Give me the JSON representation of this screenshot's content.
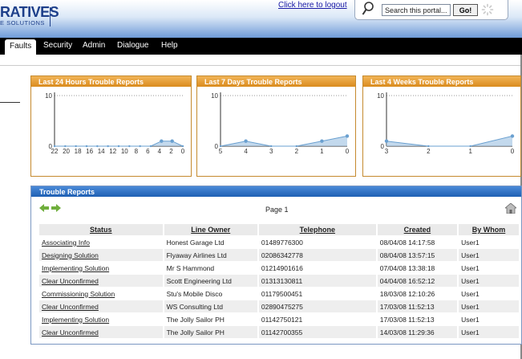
{
  "header": {
    "logo_main": "RATIVES",
    "logo_sub": "E SOLUTIONS",
    "logout_link": "Click here to logout",
    "search": {
      "value": "Search this portal...",
      "button": "Go!"
    }
  },
  "nav": {
    "tabs": [
      {
        "label": "Faults",
        "active": true
      },
      {
        "label": "Security",
        "active": false
      },
      {
        "label": "Admin",
        "active": false
      },
      {
        "label": "Dialogue",
        "active": false
      },
      {
        "label": "Help",
        "active": false
      }
    ]
  },
  "panels": [
    {
      "title": "Last 24 Hours Trouble Reports",
      "chart_data": {
        "type": "area",
        "x_ticks": [
          "22",
          "20",
          "18",
          "16",
          "14",
          "12",
          "10",
          "8",
          "6",
          "4",
          "2",
          "0"
        ],
        "ylim": [
          0,
          10
        ],
        "y_ticks": [
          "10",
          "0"
        ],
        "values": [
          0,
          0,
          0,
          0,
          0,
          0,
          0,
          0,
          0,
          0,
          1,
          1,
          0
        ]
      }
    },
    {
      "title": "Last 7 Days Trouble Reports",
      "chart_data": {
        "type": "area",
        "x_ticks": [
          "5",
          "4",
          "3",
          "2",
          "1",
          "0"
        ],
        "ylim": [
          0,
          10
        ],
        "y_ticks": [
          "10",
          "0"
        ],
        "values": [
          0,
          1,
          0,
          0,
          1,
          2
        ]
      }
    },
    {
      "title": "Last 4 Weeks Trouble Reports",
      "chart_data": {
        "type": "area",
        "x_ticks": [
          "3",
          "2",
          "1",
          "0"
        ],
        "ylim": [
          0,
          10
        ],
        "y_ticks": [
          "10",
          "0"
        ],
        "values": [
          1,
          0,
          0,
          2
        ]
      }
    }
  ],
  "reports": {
    "title": "Trouble Reports",
    "page_label": "Page 1",
    "columns": [
      "Status",
      "Line Owner",
      "Telephone",
      "Created",
      "By Whom"
    ],
    "rows": [
      {
        "status": "Associating Info",
        "owner": "Honest Garage Ltd",
        "telephone": "01489776300",
        "created": "08/04/08 14:17:58",
        "by": "User1"
      },
      {
        "status": "Designing Solution",
        "owner": "Flyaway Airlines Ltd",
        "telephone": "02086342778",
        "created": "08/04/08 13:57:15",
        "by": "User1"
      },
      {
        "status": "Implementing Solution",
        "owner": "Mr S Hammond",
        "telephone": "01214901616",
        "created": "07/04/08 13:38:18",
        "by": "User1"
      },
      {
        "status": "Clear Unconfirmed",
        "owner": "Scott Engineering Ltd",
        "telephone": "01313130811",
        "created": "04/04/08 16:52:12",
        "by": "User1"
      },
      {
        "status": "Commissioning Solution",
        "owner": "Stu's Mobile Disco",
        "telephone": "01179500451",
        "created": "18/03/08 12:10:26",
        "by": "User1"
      },
      {
        "status": "Clear Unconfirmed",
        "owner": "WS Consulting Ltd",
        "telephone": "02890475275",
        "created": "17/03/08 11:52:13",
        "by": "User1"
      },
      {
        "status": "Implementing Solution",
        "owner": "The Jolly Sailor PH",
        "telephone": "01142750121",
        "created": "17/03/08 11:52:13",
        "by": "User1"
      },
      {
        "status": "Clear Unconfirmed",
        "owner": "The Jolly Sailor PH",
        "telephone": "01142700355",
        "created": "14/03/08 11:29:36",
        "by": "User1"
      }
    ]
  },
  "colors": {
    "panel_header": "#e09a30",
    "reports_header": "#2f6fc4",
    "chart_fill": "#a9c9e6",
    "chart_line": "#6aa0d0"
  }
}
